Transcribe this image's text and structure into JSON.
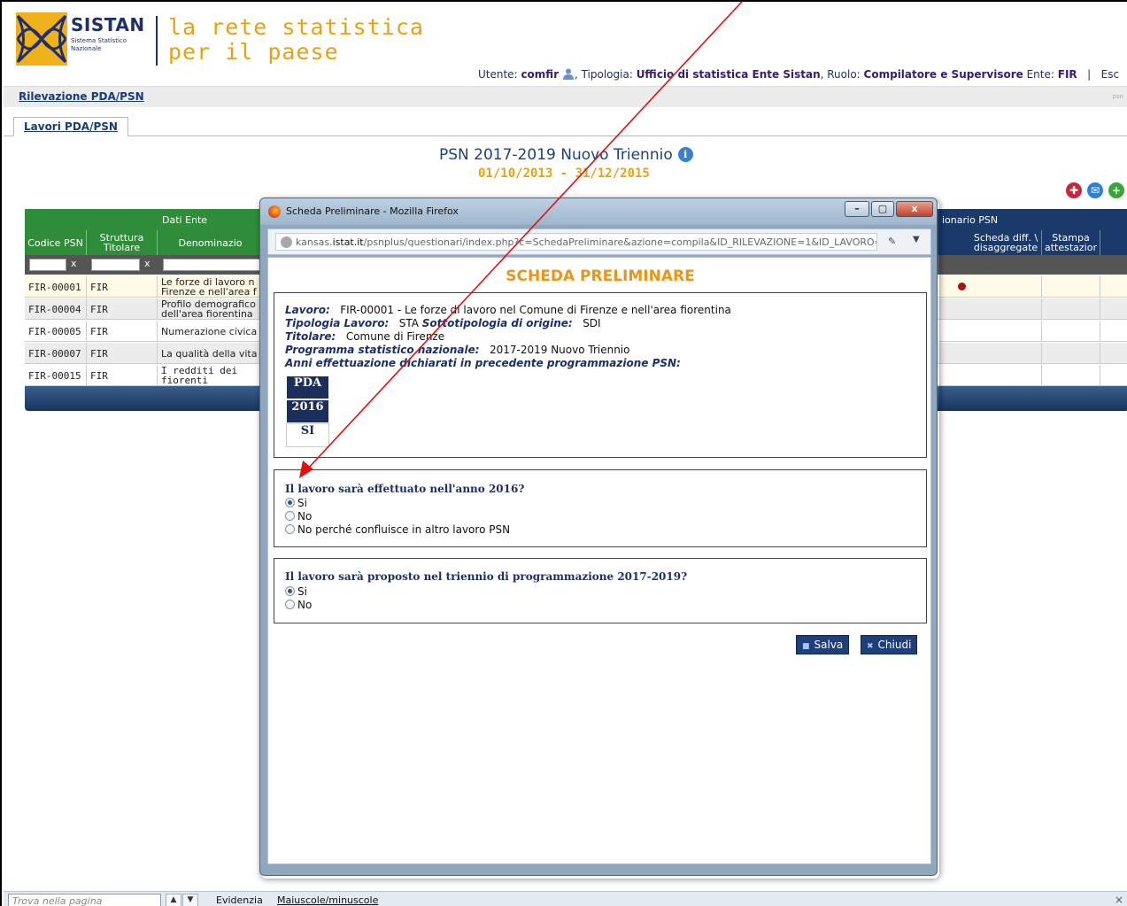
{
  "header": {
    "logo_name": "SISTAN",
    "logo_sub1": "Sistema Statistico",
    "logo_sub2": "Nazionale",
    "tagline1": "la rete statistica",
    "tagline2": "per il paese"
  },
  "user_bar": {
    "utente_label": "Utente:",
    "utente": "comfir",
    "tipologia_label": ", Tipologia:",
    "tipologia": "Ufficio di statistica Ente Sistan",
    "ruolo_label": ", Ruolo:",
    "ruolo": "Compilatore e Supervisore",
    "ente_label": "Ente:",
    "ente": "FIR",
    "sep": "|",
    "esci": "Esc"
  },
  "topnav": {
    "link": "Rilevazione PDA/PSN",
    "right": "psn"
  },
  "tabs": [
    {
      "label": "Lavori PDA/PSN"
    }
  ],
  "page": {
    "title": "PSN 2017-2019 Nuovo Triennio",
    "info_glyph": "i",
    "dates": "01/10/2013 - 31/12/2015"
  },
  "grid": {
    "group_dati": "Dati Ente",
    "group_quest": "ionario PSN",
    "col_codice": "Codice PSN",
    "col_struttura": "Struttura Titolare",
    "col_denominazione": "Denominazio",
    "col_scheda": "Scheda diff. \\ disaggregate",
    "col_stampa": "Stampa attestazior",
    "filter_clear": "x",
    "rows": [
      {
        "codice": "FIR-00001",
        "struttura": "FIR",
        "denominazione": "Le forze di lavoro n\nFirenze e nell'area f"
      },
      {
        "codice": "FIR-00004",
        "struttura": "FIR",
        "denominazione": "Profilo demografico\ndell'area fiorentina"
      },
      {
        "codice": "FIR-00005",
        "struttura": "FIR",
        "denominazione": "Numerazione civica"
      },
      {
        "codice": "FIR-00007",
        "struttura": "FIR",
        "denominazione": "La qualità della vita"
      },
      {
        "codice": "FIR-00015",
        "struttura": "FIR",
        "denominazione": "I redditi dei fiorenti"
      }
    ]
  },
  "popup": {
    "window_title": "Scheda Preliminare - Mozilla Firefox",
    "url_host": "kansas.",
    "url_host_bold": "istat.it",
    "url_path": "/psnplus/questionari/index.php?c=SchedaPreliminare&azione=compila&ID_RILEVAZIONE=1&ID_LAVORO=83",
    "sheet_title": "SCHEDA PRELIMINARE",
    "info": {
      "lavoro_label": "Lavoro:",
      "lavoro": "FIR-00001 - Le forze di lavoro nel Comune di Firenze e nell'area fiorentina",
      "tipologia_label": "Tipologia Lavoro:",
      "tipologia": "STA",
      "sottotipologia_label": "Sottotipologia di origine:",
      "sottotipologia": "SDI",
      "titolare_label": "Titolare:",
      "titolare": "Comune di Firenze",
      "programma_label": "Programma statistico nazionale:",
      "programma": "2017-2019 Nuovo Triennio",
      "anni_label": "Anni effettuazione dichiarati in precedente programmazione PSN:"
    },
    "years_table": {
      "header": "PDA",
      "year": "2016",
      "value": "SI"
    },
    "q1": {
      "title": "Il lavoro sarà effettuato nell'anno 2016?",
      "options": [
        "Si",
        "No",
        "No perché confluisce in altro lavoro PSN"
      ],
      "selected": "Si"
    },
    "q2": {
      "title": "Il lavoro sarà proposto nel triennio di programmazione 2017-2019?",
      "options": [
        "Si",
        "No"
      ],
      "selected": "Si"
    },
    "save_label": "Salva",
    "close_label": "Chiudi"
  },
  "findbar": {
    "placeholder": "Trova nella pagina",
    "highlight": "Evidenzia",
    "match_case": "Maiuscole/minuscole",
    "close": "×"
  },
  "colors": {
    "accent_orange": "#e8a112",
    "navy": "#1f2f6b",
    "grid_green": "#2f8d3a",
    "annotation_arrow": "#e01010"
  }
}
